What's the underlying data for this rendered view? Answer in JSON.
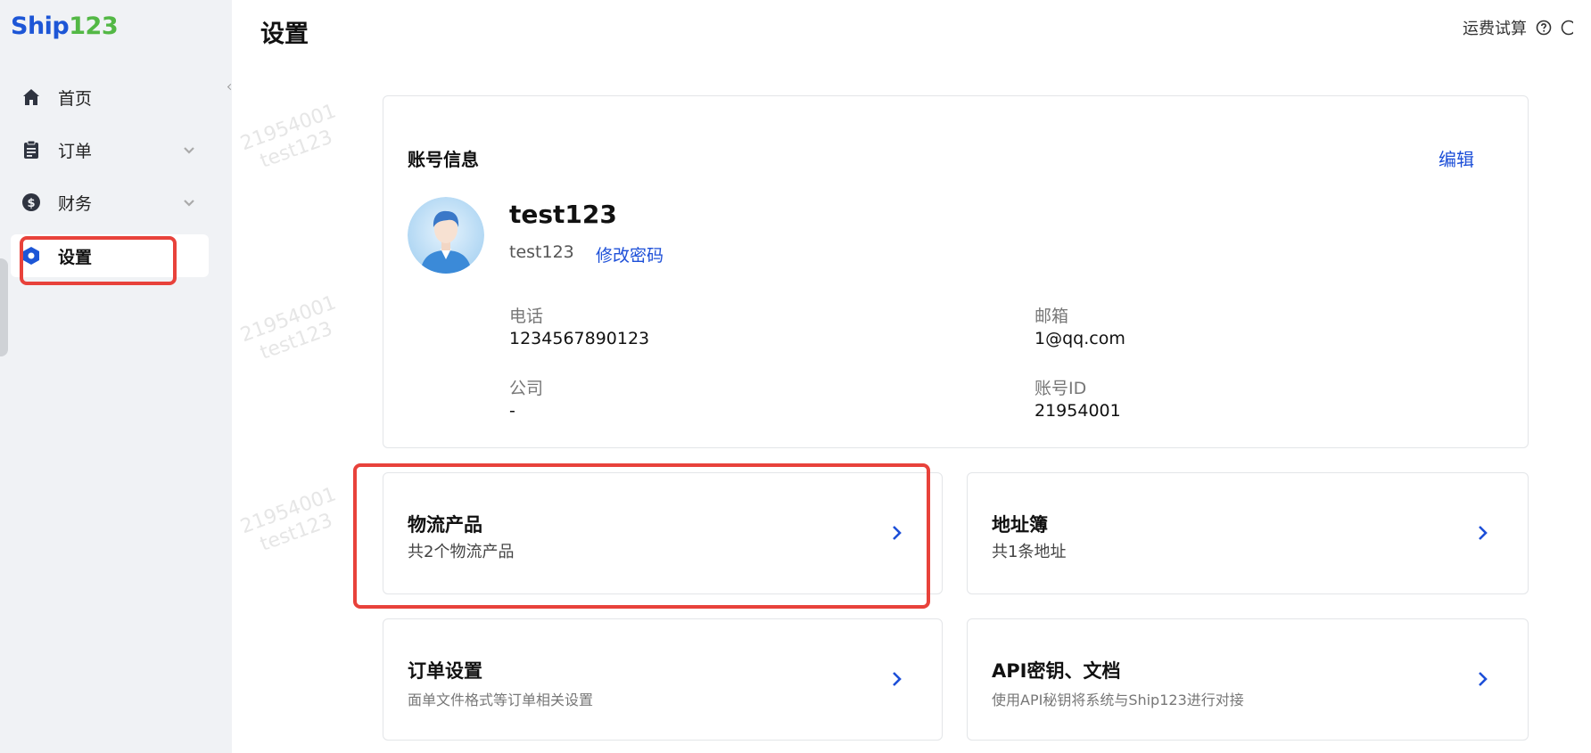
{
  "logo": {
    "ship": "Ship",
    "num": "123"
  },
  "sidebar": {
    "items": [
      {
        "label": "首页",
        "icon": "home-icon"
      },
      {
        "label": "订单",
        "icon": "clipboard-icon",
        "has_submenu": true
      },
      {
        "label": "财务",
        "icon": "finance-icon",
        "has_submenu": true
      },
      {
        "label": "设置",
        "icon": "settings-icon",
        "active": true
      }
    ]
  },
  "header": {
    "title": "设置",
    "right_link": "运费试算"
  },
  "account": {
    "section_title": "账号信息",
    "edit_label": "编辑",
    "username": "test123",
    "sub_username": "test123",
    "change_password": "修改密码",
    "phone_label": "电话",
    "phone_value": "1234567890123",
    "email_label": "邮箱",
    "email_value": "1@qq.com",
    "company_label": "公司",
    "company_value": "-",
    "account_id_label": "账号ID",
    "account_id_value": "21954001"
  },
  "cards": {
    "logistics": {
      "title": "物流产品",
      "subtitle": "共2个物流产品"
    },
    "address": {
      "title": "地址簿",
      "subtitle": "共1条地址"
    },
    "order_settings": {
      "title": "订单设置",
      "subtitle": "面单文件格式等订单相关设置"
    },
    "api": {
      "title": "API密钥、文档",
      "subtitle": "使用API秘钥将系统与Ship123进行对接"
    }
  },
  "watermark": {
    "line1": "21954001",
    "line2": "test123",
    "partial": "2"
  },
  "colors": {
    "accent": "#1d4fd8",
    "highlight": "#e8423b",
    "logo_blue": "#1d56d6",
    "logo_green": "#53b845"
  }
}
